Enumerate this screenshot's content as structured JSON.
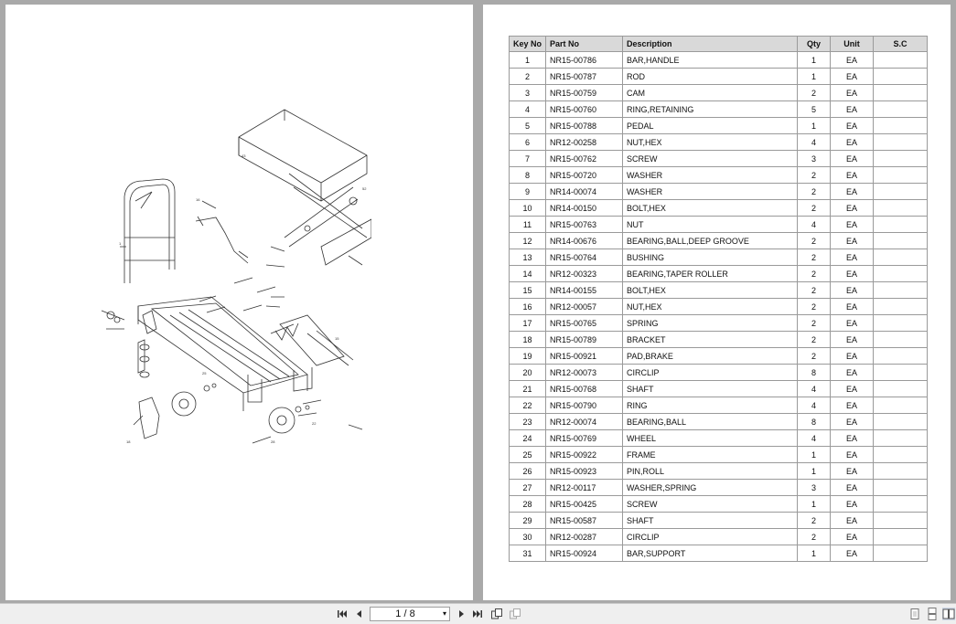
{
  "table": {
    "headers": {
      "key_no": "Key No",
      "part_no": "Part No",
      "description": "Description",
      "qty": "Qty",
      "unit": "Unit",
      "sc": "S.C"
    },
    "rows": [
      [
        "1",
        "NR15-00786",
        "BAR,HANDLE",
        "1",
        "EA",
        ""
      ],
      [
        "2",
        "NR15-00787",
        "ROD",
        "1",
        "EA",
        ""
      ],
      [
        "3",
        "NR15-00759",
        "CAM",
        "2",
        "EA",
        ""
      ],
      [
        "4",
        "NR15-00760",
        "RING,RETAINING",
        "5",
        "EA",
        ""
      ],
      [
        "5",
        "NR15-00788",
        "PEDAL",
        "1",
        "EA",
        ""
      ],
      [
        "6",
        "NR12-00258",
        "NUT,HEX",
        "4",
        "EA",
        ""
      ],
      [
        "7",
        "NR15-00762",
        "SCREW",
        "3",
        "EA",
        ""
      ],
      [
        "8",
        "NR15-00720",
        "WASHER",
        "2",
        "EA",
        ""
      ],
      [
        "9",
        "NR14-00074",
        "WASHER",
        "2",
        "EA",
        ""
      ],
      [
        "10",
        "NR14-00150",
        "BOLT,HEX",
        "2",
        "EA",
        ""
      ],
      [
        "11",
        "NR15-00763",
        "NUT",
        "4",
        "EA",
        ""
      ],
      [
        "12",
        "NR14-00676",
        "BEARING,BALL,DEEP GROOVE",
        "2",
        "EA",
        ""
      ],
      [
        "13",
        "NR15-00764",
        "BUSHING",
        "2",
        "EA",
        ""
      ],
      [
        "14",
        "NR12-00323",
        "BEARING,TAPER ROLLER",
        "2",
        "EA",
        ""
      ],
      [
        "15",
        "NR14-00155",
        "BOLT,HEX",
        "2",
        "EA",
        ""
      ],
      [
        "16",
        "NR12-00057",
        "NUT,HEX",
        "2",
        "EA",
        ""
      ],
      [
        "17",
        "NR15-00765",
        "SPRING",
        "2",
        "EA",
        ""
      ],
      [
        "18",
        "NR15-00789",
        "BRACKET",
        "2",
        "EA",
        ""
      ],
      [
        "19",
        "NR15-00921",
        "PAD,BRAKE",
        "2",
        "EA",
        ""
      ],
      [
        "20",
        "NR12-00073",
        "CIRCLIP",
        "8",
        "EA",
        ""
      ],
      [
        "21",
        "NR15-00768",
        "SHAFT",
        "4",
        "EA",
        ""
      ],
      [
        "22",
        "NR15-00790",
        "RING",
        "4",
        "EA",
        ""
      ],
      [
        "23",
        "NR12-00074",
        "BEARING,BALL",
        "8",
        "EA",
        ""
      ],
      [
        "24",
        "NR15-00769",
        "WHEEL",
        "4",
        "EA",
        ""
      ],
      [
        "25",
        "NR15-00922",
        "FRAME",
        "1",
        "EA",
        ""
      ],
      [
        "26",
        "NR15-00923",
        "PIN,ROLL",
        "1",
        "EA",
        ""
      ],
      [
        "27",
        "NR12-00117",
        "WASHER,SPRING",
        "3",
        "EA",
        ""
      ],
      [
        "28",
        "NR15-00425",
        "SCREW",
        "1",
        "EA",
        ""
      ],
      [
        "29",
        "NR15-00587",
        "SHAFT",
        "2",
        "EA",
        ""
      ],
      [
        "30",
        "NR12-00287",
        "CIRCLIP",
        "2",
        "EA",
        ""
      ],
      [
        "31",
        "NR15-00924",
        "BAR,SUPPORT",
        "1",
        "EA",
        ""
      ]
    ]
  },
  "toolbar": {
    "page_indicator": "1 / 8",
    "icons": [
      "first-page-icon",
      "prev-page-icon",
      "next-page-icon",
      "last-page-icon",
      "rotate-icon",
      "fit-icon",
      "single-page-view-icon",
      "continuous-view-icon",
      "two-page-view-icon"
    ]
  },
  "colors": {
    "viewer_background": "#a9a9a9",
    "header_fill": "#d9d9d9",
    "table_border": "#9a9a9a"
  }
}
